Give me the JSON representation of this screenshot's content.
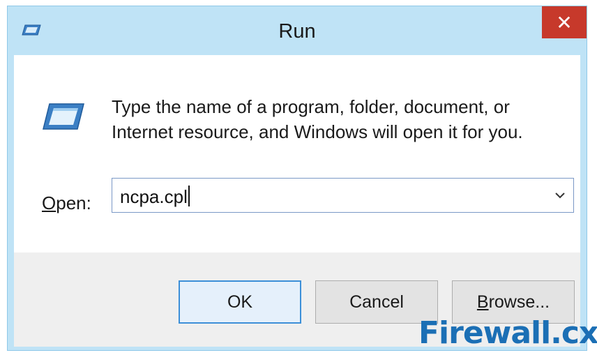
{
  "window": {
    "title": "Run",
    "close_glyph": "✕"
  },
  "icons": {
    "title_icon": "run-app-icon",
    "content_icon": "run-app-icon",
    "close_icon": "close-icon",
    "dropdown_icon": "chevron-down-icon"
  },
  "content": {
    "description_line1": "Type the name of a program, folder, document, or",
    "description_line2": "Internet resource, and Windows will open it for you.",
    "open_label_underlined": "O",
    "open_label_rest": "pen:",
    "open_value": "ncpa.cpl"
  },
  "buttons": {
    "ok": "OK",
    "cancel": "Cancel",
    "browse_underlined": "B",
    "browse_rest": "rowse..."
  },
  "watermark": "Firewall.cx",
  "colors": {
    "close_button": "#c7392b",
    "frame": "#bfe3f6",
    "accent": "#3c8fd8",
    "watermark": "#1b6fb5"
  }
}
